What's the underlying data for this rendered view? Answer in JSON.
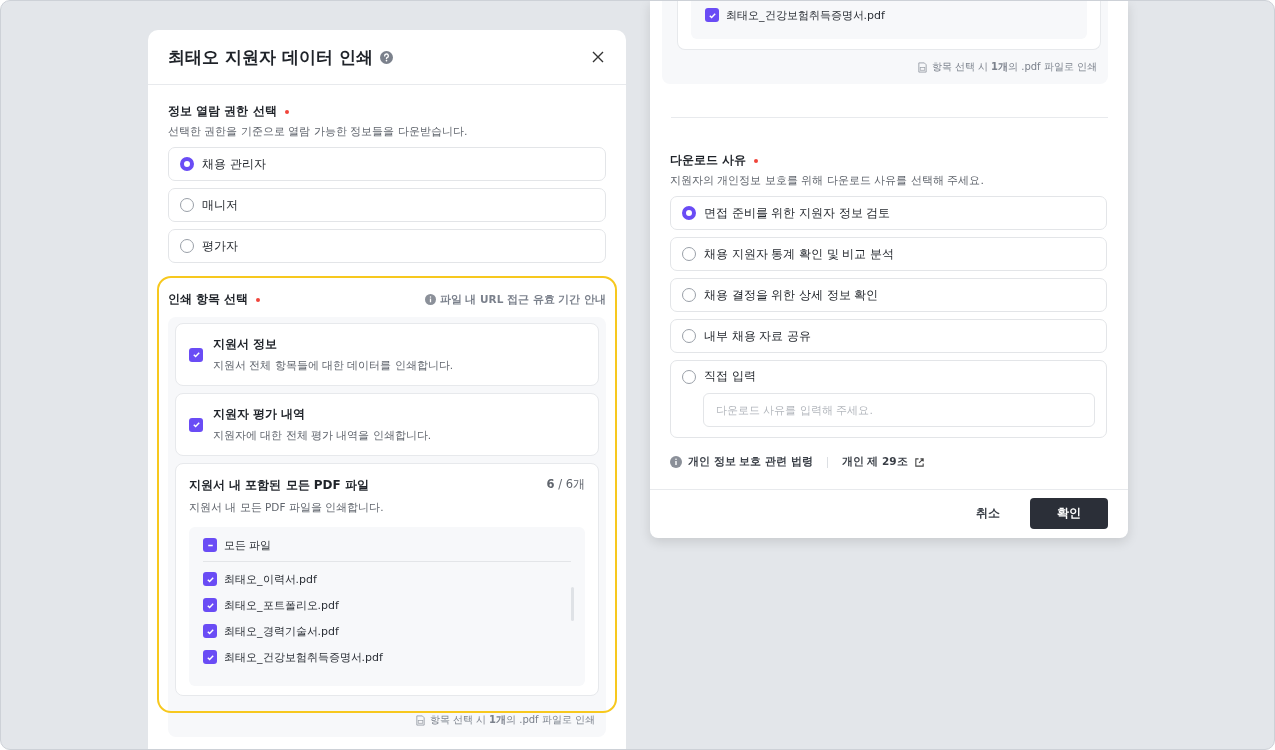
{
  "print_dialog": {
    "title": "최태오 지원자 데이터 인쇄",
    "permission": {
      "label": "정보 열람 권한 선택",
      "required": true,
      "description": "선택한 권한을 기준으로 열람 가능한 정보들을 다운받습니다.",
      "options": [
        {
          "label": "채용 관리자",
          "selected": true
        },
        {
          "label": "매니저",
          "selected": false
        },
        {
          "label": "평가자",
          "selected": false
        }
      ]
    },
    "print_items": {
      "label": "인쇄 항목 선택",
      "required": true,
      "highlighted": true,
      "info_link": "파일 내 URL 접근 유효 기간 안내",
      "items": [
        {
          "kind": "option",
          "title": "지원서 정보",
          "description": "지원서 전체 항목들에 대한 데이터를 인쇄합니다.",
          "checked": true
        },
        {
          "kind": "option",
          "title": "지원자 평가 내역",
          "description": "지원자에 대한 전체 평가 내역을 인쇄합니다.",
          "checked": true
        },
        {
          "kind": "files",
          "title": "지원서 내 포함된 모든 PDF 파일",
          "count": "**6** / 6개",
          "description": "지원서 내 모든 PDF 파일을 인쇄합니다.",
          "all_files": {
            "label": "모든 파일",
            "indeterminate": true
          },
          "files": [
            {
              "name": "최태오_이력서.pdf",
              "checked": true
            },
            {
              "name": "최태오_포트폴리오.pdf",
              "checked": true
            },
            {
              "name": "최태오_경력기술서.pdf",
              "checked": true
            },
            {
              "name": "최태오_건강보험취득증명서.pdf",
              "checked": true
            }
          ]
        }
      ],
      "note": "항목 선택 시 **1개**의 .pdf 파일로 인쇄"
    }
  },
  "reason_dialog": {
    "files": [
      {
        "name": "최태오_건강보험취득증명서.pdf",
        "checked": true
      }
    ],
    "note": "항목 선택 시 **1개**의 .pdf 파일로 인쇄",
    "reason": {
      "label": "다운로드 사유",
      "required": true,
      "description": "지원자의 개인정보 보호를 위해 다운로드 사유를 선택해 주세요.",
      "options": [
        {
          "kind": "plain",
          "label": "면접 준비를 위한 지원자 정보 검토",
          "selected": true
        },
        {
          "kind": "plain",
          "label": "채용 지원자 통계 확인 및 비교 분석",
          "selected": false
        },
        {
          "kind": "plain",
          "label": "채용 결정을 위한 상세 정보 확인",
          "selected": false
        },
        {
          "kind": "plain",
          "label": "내부 채용 자료 공유",
          "selected": false
        },
        {
          "kind": "custom",
          "label": "직접 입력",
          "selected": false,
          "placeholder": "다운로드 사유를 입력해 주세요."
        }
      ]
    },
    "legal": {
      "label": "개인 정보 보호 관련 법령",
      "link": "개인 제 29조"
    },
    "buttons": [
      {
        "label": "취소",
        "kind": "secondary"
      },
      {
        "label": "확인",
        "kind": "primary"
      }
    ]
  }
}
